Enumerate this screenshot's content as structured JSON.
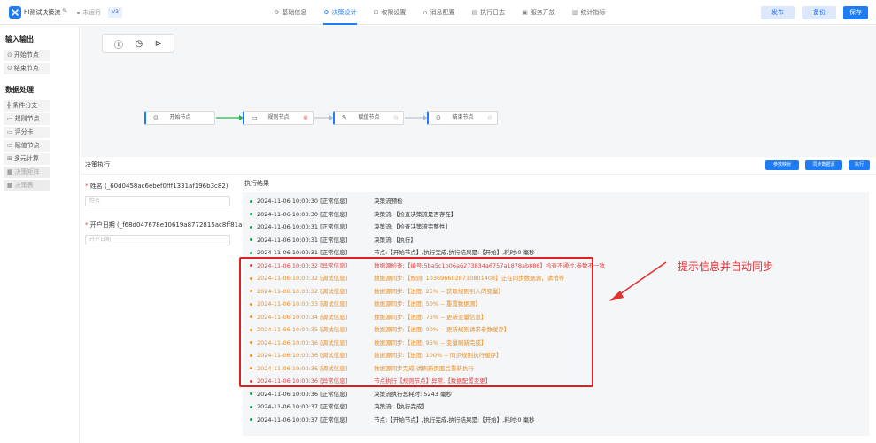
{
  "header": {
    "app_name": "hl测试决策流",
    "status": "未运行",
    "version": "V3",
    "tabs": [
      {
        "label": "基础信息",
        "icon": "gear-icon"
      },
      {
        "label": "决策设计",
        "icon": "gear-icon",
        "active": true
      },
      {
        "label": "权限设置",
        "icon": "lock-icon"
      },
      {
        "label": "消息配置",
        "icon": "headset-icon"
      },
      {
        "label": "执行日志",
        "icon": "document-icon"
      },
      {
        "label": "服务开放",
        "icon": "service-icon"
      },
      {
        "label": "统计指标",
        "icon": "chart-icon"
      }
    ],
    "publish_label": "发布",
    "backup_label": "备份",
    "save_label": "保存"
  },
  "sidebar": {
    "group1": "输入输出",
    "io_items": [
      {
        "label": "开始节点",
        "icon": "start-icon"
      },
      {
        "label": "结束节点",
        "icon": "end-icon"
      }
    ],
    "group2": "数据处理",
    "data_items": [
      {
        "label": "条件分支",
        "icon": "branch-icon"
      },
      {
        "label": "规则节点",
        "icon": "rule-icon"
      },
      {
        "label": "评分卡",
        "icon": "scorecard-icon"
      },
      {
        "label": "赋值节点",
        "icon": "assign-icon"
      },
      {
        "label": "多元计算",
        "icon": "calc-icon"
      },
      {
        "label": "决策矩阵",
        "icon": "matrix-icon",
        "disabled": true
      },
      {
        "label": "决策表",
        "icon": "table-icon",
        "disabled": true
      }
    ]
  },
  "canvas": {
    "nodes": [
      {
        "label": "开始节点",
        "icon": "start-icon"
      },
      {
        "label": "规则节点",
        "icon": "rule-icon"
      },
      {
        "label": "赋值节点",
        "icon": "assign-icon"
      },
      {
        "label": "结束节点",
        "icon": "end-icon"
      }
    ]
  },
  "execute_panel": {
    "title": "决策执行",
    "param_mapping_label": "参数映射",
    "sync_data_label": "同步数据源",
    "run_label": "执行",
    "fields": [
      {
        "label": "姓名 (_60d0458ac6ebef0fff1331af196b3c82)",
        "placeholder": "姓名"
      },
      {
        "label": "开户日期 (_f68d047678e10619a8772815ac8ff81a)",
        "placeholder": "开户日期"
      }
    ],
    "result_title": "执行结果",
    "logs": [
      {
        "time": "2024-11-06 10:00:30",
        "level": "[正常信息]",
        "message": "决策流预检",
        "type": "norm"
      },
      {
        "time": "2024-11-06 10:00:30",
        "level": "[正常信息]",
        "message": "决策流:【检查决策流是否存在】",
        "type": "norm"
      },
      {
        "time": "2024-11-06 10:00:31",
        "level": "[正常信息]",
        "message": "决策流:【检查决策流完整性】",
        "type": "norm"
      },
      {
        "time": "2024-11-06 10:00:31",
        "level": "[正常信息]",
        "message": "决策流:【执行】",
        "type": "norm"
      },
      {
        "time": "2024-11-06 10:00:31",
        "level": "[正常信息]",
        "message": "节点:【开始节点】,执行完成,执行结果是:【开始】,耗时:0 毫秒",
        "type": "norm"
      },
      {
        "time": "2024-11-06 10:00:32",
        "level": "[异常信息]",
        "message": "数据源检查:【编号:5ba5c1b06a6273834a6757a1878ab886】检查不通过,参数不一致",
        "type": "err"
      },
      {
        "time": "2024-11-06 10:00:32",
        "level": "[调试信息]",
        "message": "数据源同步:【规则: 1036966028710801408】正在同步数据源，请稍等",
        "type": "warn"
      },
      {
        "time": "2024-11-06 10:00:32",
        "level": "[调试信息]",
        "message": "数据源同步:【进度: 25% -- 获取规则引入的变量】",
        "type": "warn"
      },
      {
        "time": "2024-11-06 10:00:33",
        "level": "[调试信息]",
        "message": "数据源同步:【进度: 50% -- 重置数据源】",
        "type": "warn"
      },
      {
        "time": "2024-11-06 10:00:34",
        "level": "[调试信息]",
        "message": "数据源同步:【进度: 75% -- 更新变量信息】",
        "type": "warn"
      },
      {
        "time": "2024-11-06 10:00:35",
        "level": "[调试信息]",
        "message": "数据源同步:【进度: 90% -- 更新规则请求参数缓存】",
        "type": "warn"
      },
      {
        "time": "2024-11-06 10:00:36",
        "level": "[调试信息]",
        "message": "数据源同步:【进度: 95% -- 变量刷新完成】",
        "type": "warn"
      },
      {
        "time": "2024-11-06 10:00:36",
        "level": "[调试信息]",
        "message": "数据源同步:【进度: 100% -- 同步规则执行缓存】",
        "type": "warn"
      },
      {
        "time": "2024-11-06 10:00:36",
        "level": "[调试信息]",
        "message": "数据源同步完成:请刷新页面后重新执行",
        "type": "warn"
      },
      {
        "time": "2024-11-06 10:00:36",
        "level": "[异常信息]",
        "message": "节点执行【规则节点】异常,【数据配置变更】",
        "type": "err"
      },
      {
        "time": "2024-11-06 10:00:36",
        "level": "[正常信息]",
        "message": "决策流执行总耗时: 5243 毫秒",
        "type": "norm"
      },
      {
        "time": "2024-11-06 10:00:37",
        "level": "[正常信息]",
        "message": "决策流:【执行完成】",
        "type": "norm"
      },
      {
        "time": "2024-11-06 10:00:37",
        "level": "[正常信息]",
        "message": "节点:【开始节点】,执行完成,执行结果是:【开始】,耗时:0 毫秒",
        "type": "norm"
      }
    ]
  },
  "annotation": {
    "text": "提示信息并自动同步",
    "color": "#e53030"
  },
  "colors": {
    "accent": "#1e7cf5",
    "error": "#e04545",
    "debug": "#e8902a",
    "normal_dot": "#1d9a52"
  }
}
